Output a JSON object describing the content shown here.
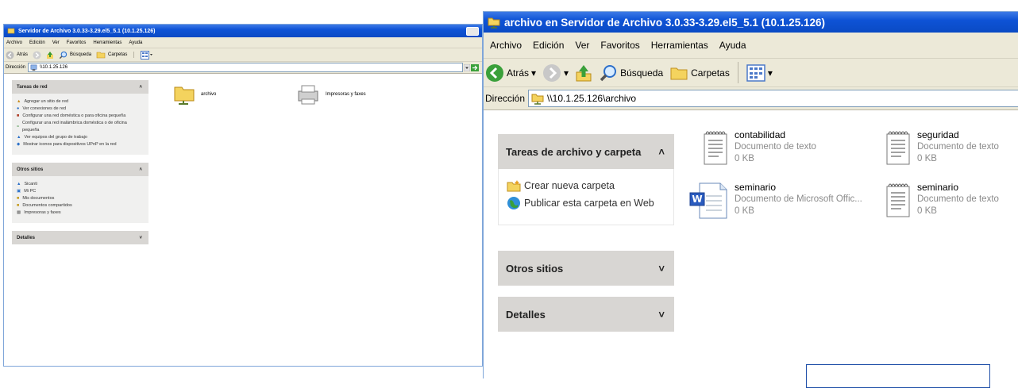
{
  "back_window": {
    "title": "Servidor de Archivo 3.0.33-3.29.el5_5.1 (10.1.25.126)",
    "menu": [
      "Archivo",
      "Edición",
      "Ver",
      "Favoritos",
      "Herramientas",
      "Ayuda"
    ],
    "toolbar": {
      "back": "Atrás",
      "search": "Búsqueda",
      "folders": "Carpetas"
    },
    "address": {
      "label": "Dirección",
      "value": "\\\\10.1.25.126"
    },
    "network_tasks": {
      "title": "Tareas de red",
      "items": [
        "Agregar un sitio de red",
        "Ver conexiones de red",
        "Configurar una red doméstica o para oficina pequeña",
        "Configurar una red inalámbrica doméstica o de oficina pequeña",
        "Ver equipos del grupo de trabajo",
        "Mostrar iconos para dispositivos UPnP en la red"
      ]
    },
    "other_places": {
      "title": "Otros sitios",
      "items": [
        "Sicanti",
        "Mi PC",
        "Mis documentos",
        "Documentos compartidos",
        "Impresoras y faxes"
      ]
    },
    "details": {
      "title": "Detalles"
    },
    "items": [
      {
        "name": "archivo",
        "icon": "network-share-icon"
      },
      {
        "name": "Impresoras y faxes",
        "icon": "printer-icon"
      }
    ]
  },
  "front_window": {
    "title": "archivo en Servidor de Archivo 3.0.33-3.29.el5_5.1 (10.1.25.126)",
    "menu": [
      "Archivo",
      "Edición",
      "Ver",
      "Favoritos",
      "Herramientas",
      "Ayuda"
    ],
    "toolbar": {
      "back": "Atrás",
      "search": "Búsqueda",
      "folders": "Carpetas"
    },
    "address": {
      "label": "Dirección",
      "value": "\\\\10.1.25.126\\archivo"
    },
    "file_tasks": {
      "title": "Tareas de archivo y carpeta",
      "items": [
        "Crear nueva carpeta",
        "Publicar esta carpeta en Web"
      ]
    },
    "other_places": {
      "title": "Otros sitios"
    },
    "details": {
      "title": "Detalles"
    },
    "files": [
      {
        "name": "contabilidad",
        "type": "Documento de texto",
        "size": "0 KB",
        "icon": "text-document-icon"
      },
      {
        "name": "seguridad",
        "type": "Documento de texto",
        "size": "0 KB",
        "icon": "text-document-icon"
      },
      {
        "name": "seminario",
        "type": "Documento de Microsoft Offic...",
        "size": "0 KB",
        "icon": "word-document-icon"
      },
      {
        "name": "seminario",
        "type": "Documento de texto",
        "size": "0 KB",
        "icon": "text-document-icon"
      }
    ]
  },
  "colors": {
    "titlebar": "#0e53d6",
    "chrome": "#ece9d8",
    "panel_header": "#d8d6d3",
    "border": "#7fa6d9"
  }
}
